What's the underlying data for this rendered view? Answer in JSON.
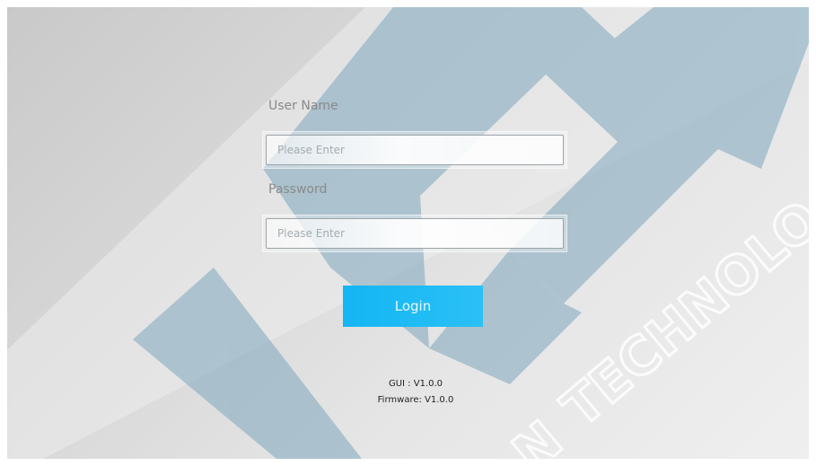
{
  "form": {
    "username_label": "User Name",
    "username_placeholder": "Please Enter",
    "username_value": "",
    "password_label": "Password",
    "password_placeholder": "Please Enter",
    "password_value": "",
    "login_label": "Login"
  },
  "footer": {
    "gui_version": "GUI : V1.0.0",
    "firmware_version": "Firmware: V1.0.0"
  },
  "watermark": {
    "text": "TECHNOLO",
    "tail_text": "N"
  },
  "colors": {
    "accent": "#1ab8f4",
    "watermark_shape": "#7ea7bd",
    "background": "#d9d9d9"
  },
  "icons": {
    "watermark_logo": "brand-logo-icon"
  }
}
